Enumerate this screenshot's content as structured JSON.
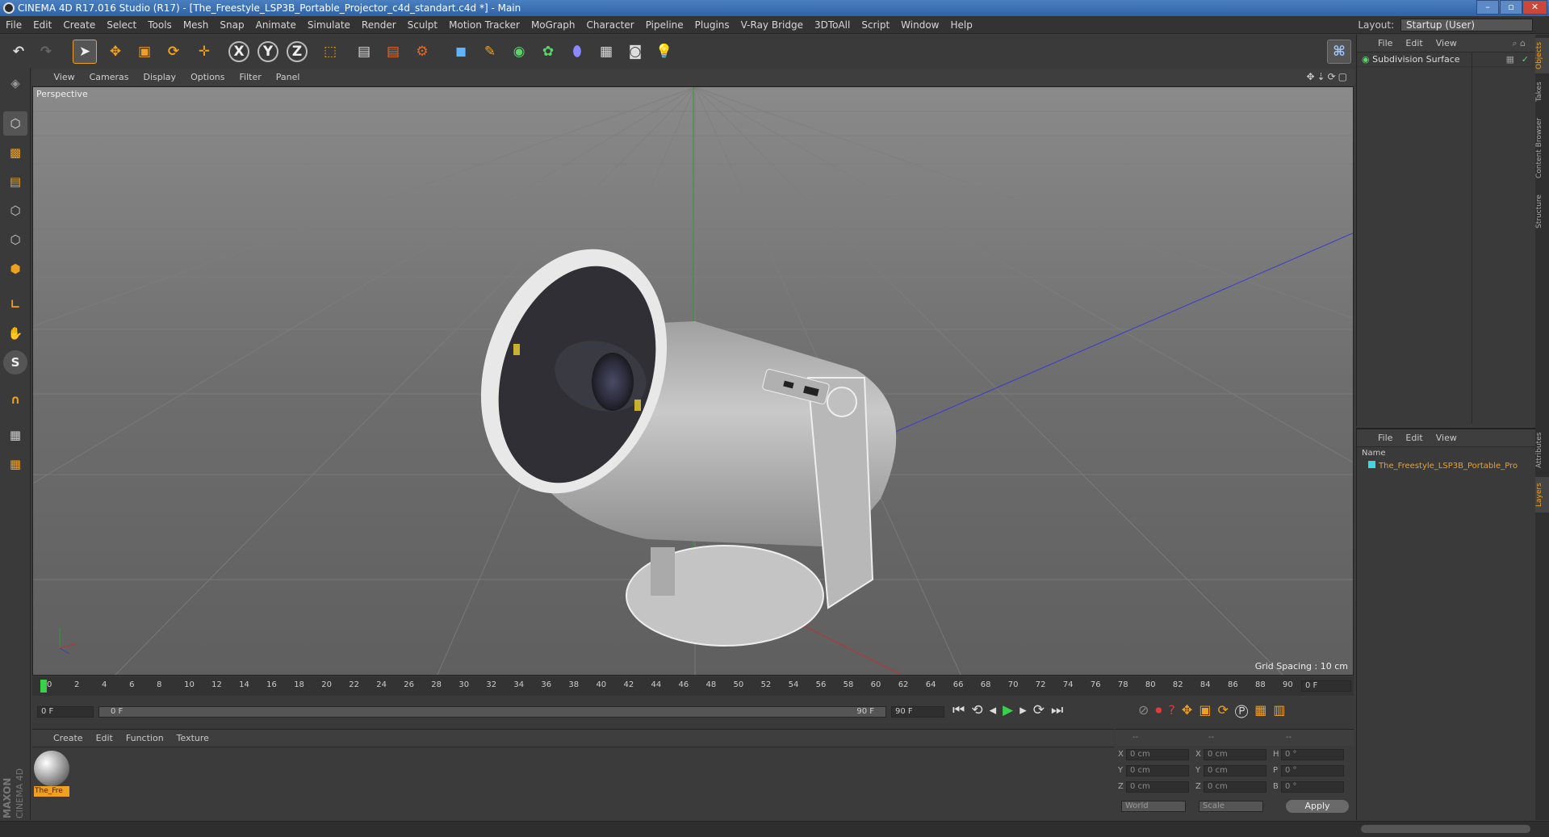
{
  "window": {
    "title": "CINEMA 4D R17.016 Studio (R17) - [The_Freestyle_LSP3B_Portable_Projector_c4d_standart.c4d *] - Main"
  },
  "menubar": {
    "items": [
      "File",
      "Edit",
      "Create",
      "Select",
      "Tools",
      "Mesh",
      "Snap",
      "Animate",
      "Simulate",
      "Render",
      "Sculpt",
      "Motion Tracker",
      "MoGraph",
      "Character",
      "Pipeline",
      "Plugins",
      "V-Ray Bridge",
      "3DToAll",
      "Script",
      "Window",
      "Help"
    ],
    "layout_label": "Layout:",
    "layout_value": "Startup (User)"
  },
  "viewport": {
    "menu": [
      "View",
      "Cameras",
      "Display",
      "Options",
      "Filter",
      "Panel"
    ],
    "camera_label": "Perspective",
    "grid_spacing": "Grid Spacing : 10 cm"
  },
  "timeline": {
    "ticks": [
      "0",
      "2",
      "4",
      "6",
      "8",
      "10",
      "12",
      "14",
      "16",
      "18",
      "20",
      "22",
      "24",
      "26",
      "28",
      "30",
      "32",
      "34",
      "36",
      "38",
      "40",
      "42",
      "44",
      "46",
      "48",
      "50",
      "52",
      "54",
      "56",
      "58",
      "60",
      "62",
      "64",
      "66",
      "68",
      "70",
      "72",
      "74",
      "76",
      "78",
      "80",
      "82",
      "84",
      "86",
      "88",
      "90"
    ],
    "current_frame": "0 F",
    "start_field": "0 F",
    "range_start": "0 F",
    "range_end": "90 F",
    "end_field": "90 F"
  },
  "material_panel": {
    "menu": [
      "Create",
      "Edit",
      "Function",
      "Texture"
    ],
    "material_name": "The_Fre"
  },
  "coords": {
    "headers": [
      "--",
      "--",
      "--"
    ],
    "rows": [
      {
        "a": "X",
        "av": "0 cm",
        "b": "X",
        "bv": "0 cm",
        "c": "H",
        "cv": "0 °"
      },
      {
        "a": "Y",
        "av": "0 cm",
        "b": "Y",
        "bv": "0 cm",
        "c": "P",
        "cv": "0 °"
      },
      {
        "a": "Z",
        "av": "0 cm",
        "b": "Z",
        "bv": "0 cm",
        "c": "B",
        "cv": "0 °"
      }
    ],
    "mode1": "World",
    "mode2": "Scale",
    "apply": "Apply"
  },
  "objects_panel": {
    "menu": [
      "File",
      "Edit",
      "View"
    ],
    "object_name": "Subdivision Surface"
  },
  "layers_panel": {
    "menu": [
      "File",
      "Edit",
      "View"
    ],
    "column": "Name",
    "layer_name": "The_Freestyle_LSP3B_Portable_Pro"
  },
  "side_tabs": [
    "Objects",
    "Takes",
    "Content Browser",
    "Structure",
    "Attributes",
    "Layers"
  ],
  "brand": {
    "line1": "MAXON",
    "line2": "CINEMA 4D"
  },
  "colors": {
    "accent_orange": "#f0a020",
    "title_blue": "#3a70b5",
    "layer_cyan": "#3ed6e6"
  }
}
